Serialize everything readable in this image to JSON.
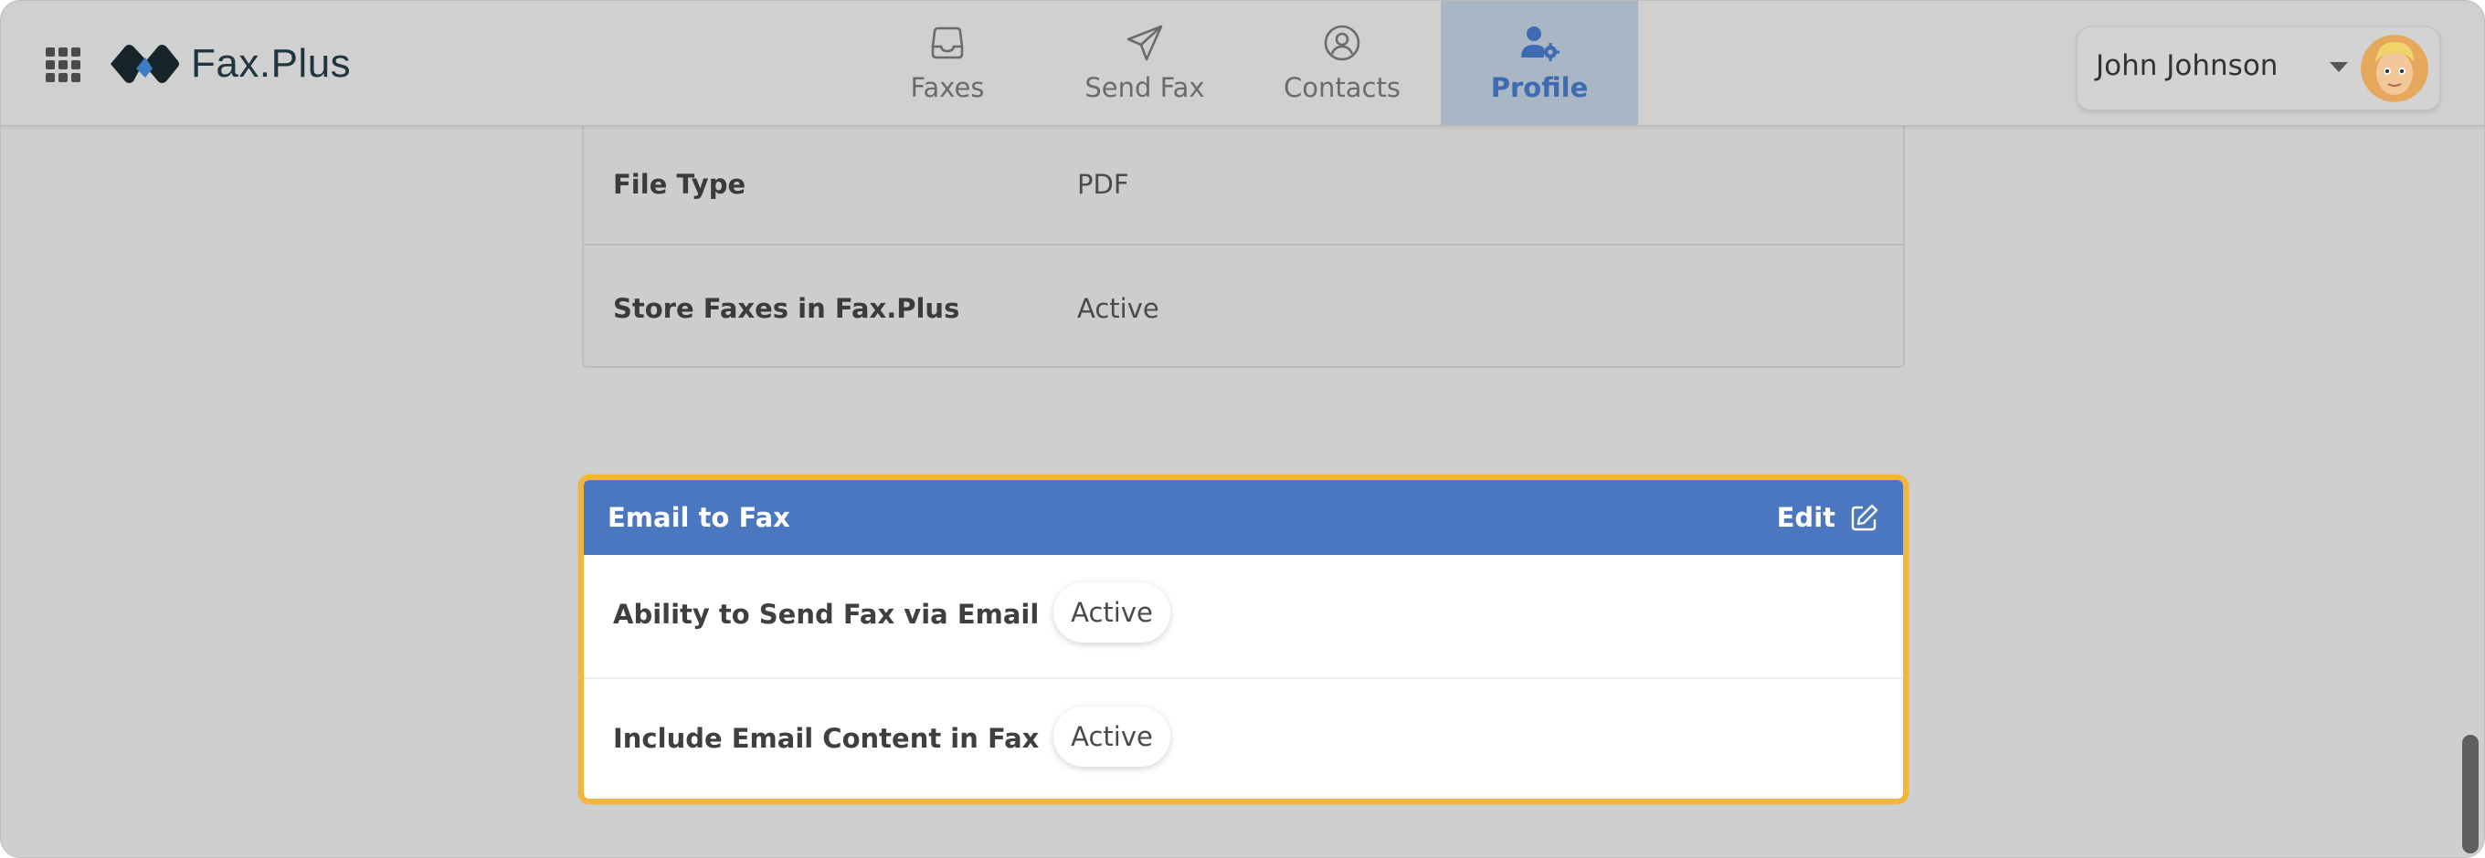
{
  "header": {
    "brand": "Fax.Plus",
    "nav": [
      {
        "label": "Faxes",
        "icon": "inbox-icon"
      },
      {
        "label": "Send Fax",
        "icon": "paper-plane-icon"
      },
      {
        "label": "Contacts",
        "icon": "user-circle-icon"
      },
      {
        "label": "Profile",
        "icon": "user-cog-icon",
        "active": true
      }
    ],
    "user": {
      "name": "John Johnson"
    }
  },
  "settings_card": {
    "rows": [
      {
        "label": "File Type",
        "value": "PDF"
      },
      {
        "label": "Store Faxes in Fax.Plus",
        "value": "Active"
      }
    ]
  },
  "email_to_fax": {
    "title": "Email to Fax",
    "edit_label": "Edit",
    "rows": [
      {
        "label": "Ability to Send Fax via Email",
        "value": "Active"
      },
      {
        "label": "Include Email Content in Fax",
        "value": "Active"
      }
    ]
  },
  "colors": {
    "accent": "#4b77c0",
    "highlight": "#f4b63a",
    "active_nav_bg": "#a9b6c6"
  }
}
